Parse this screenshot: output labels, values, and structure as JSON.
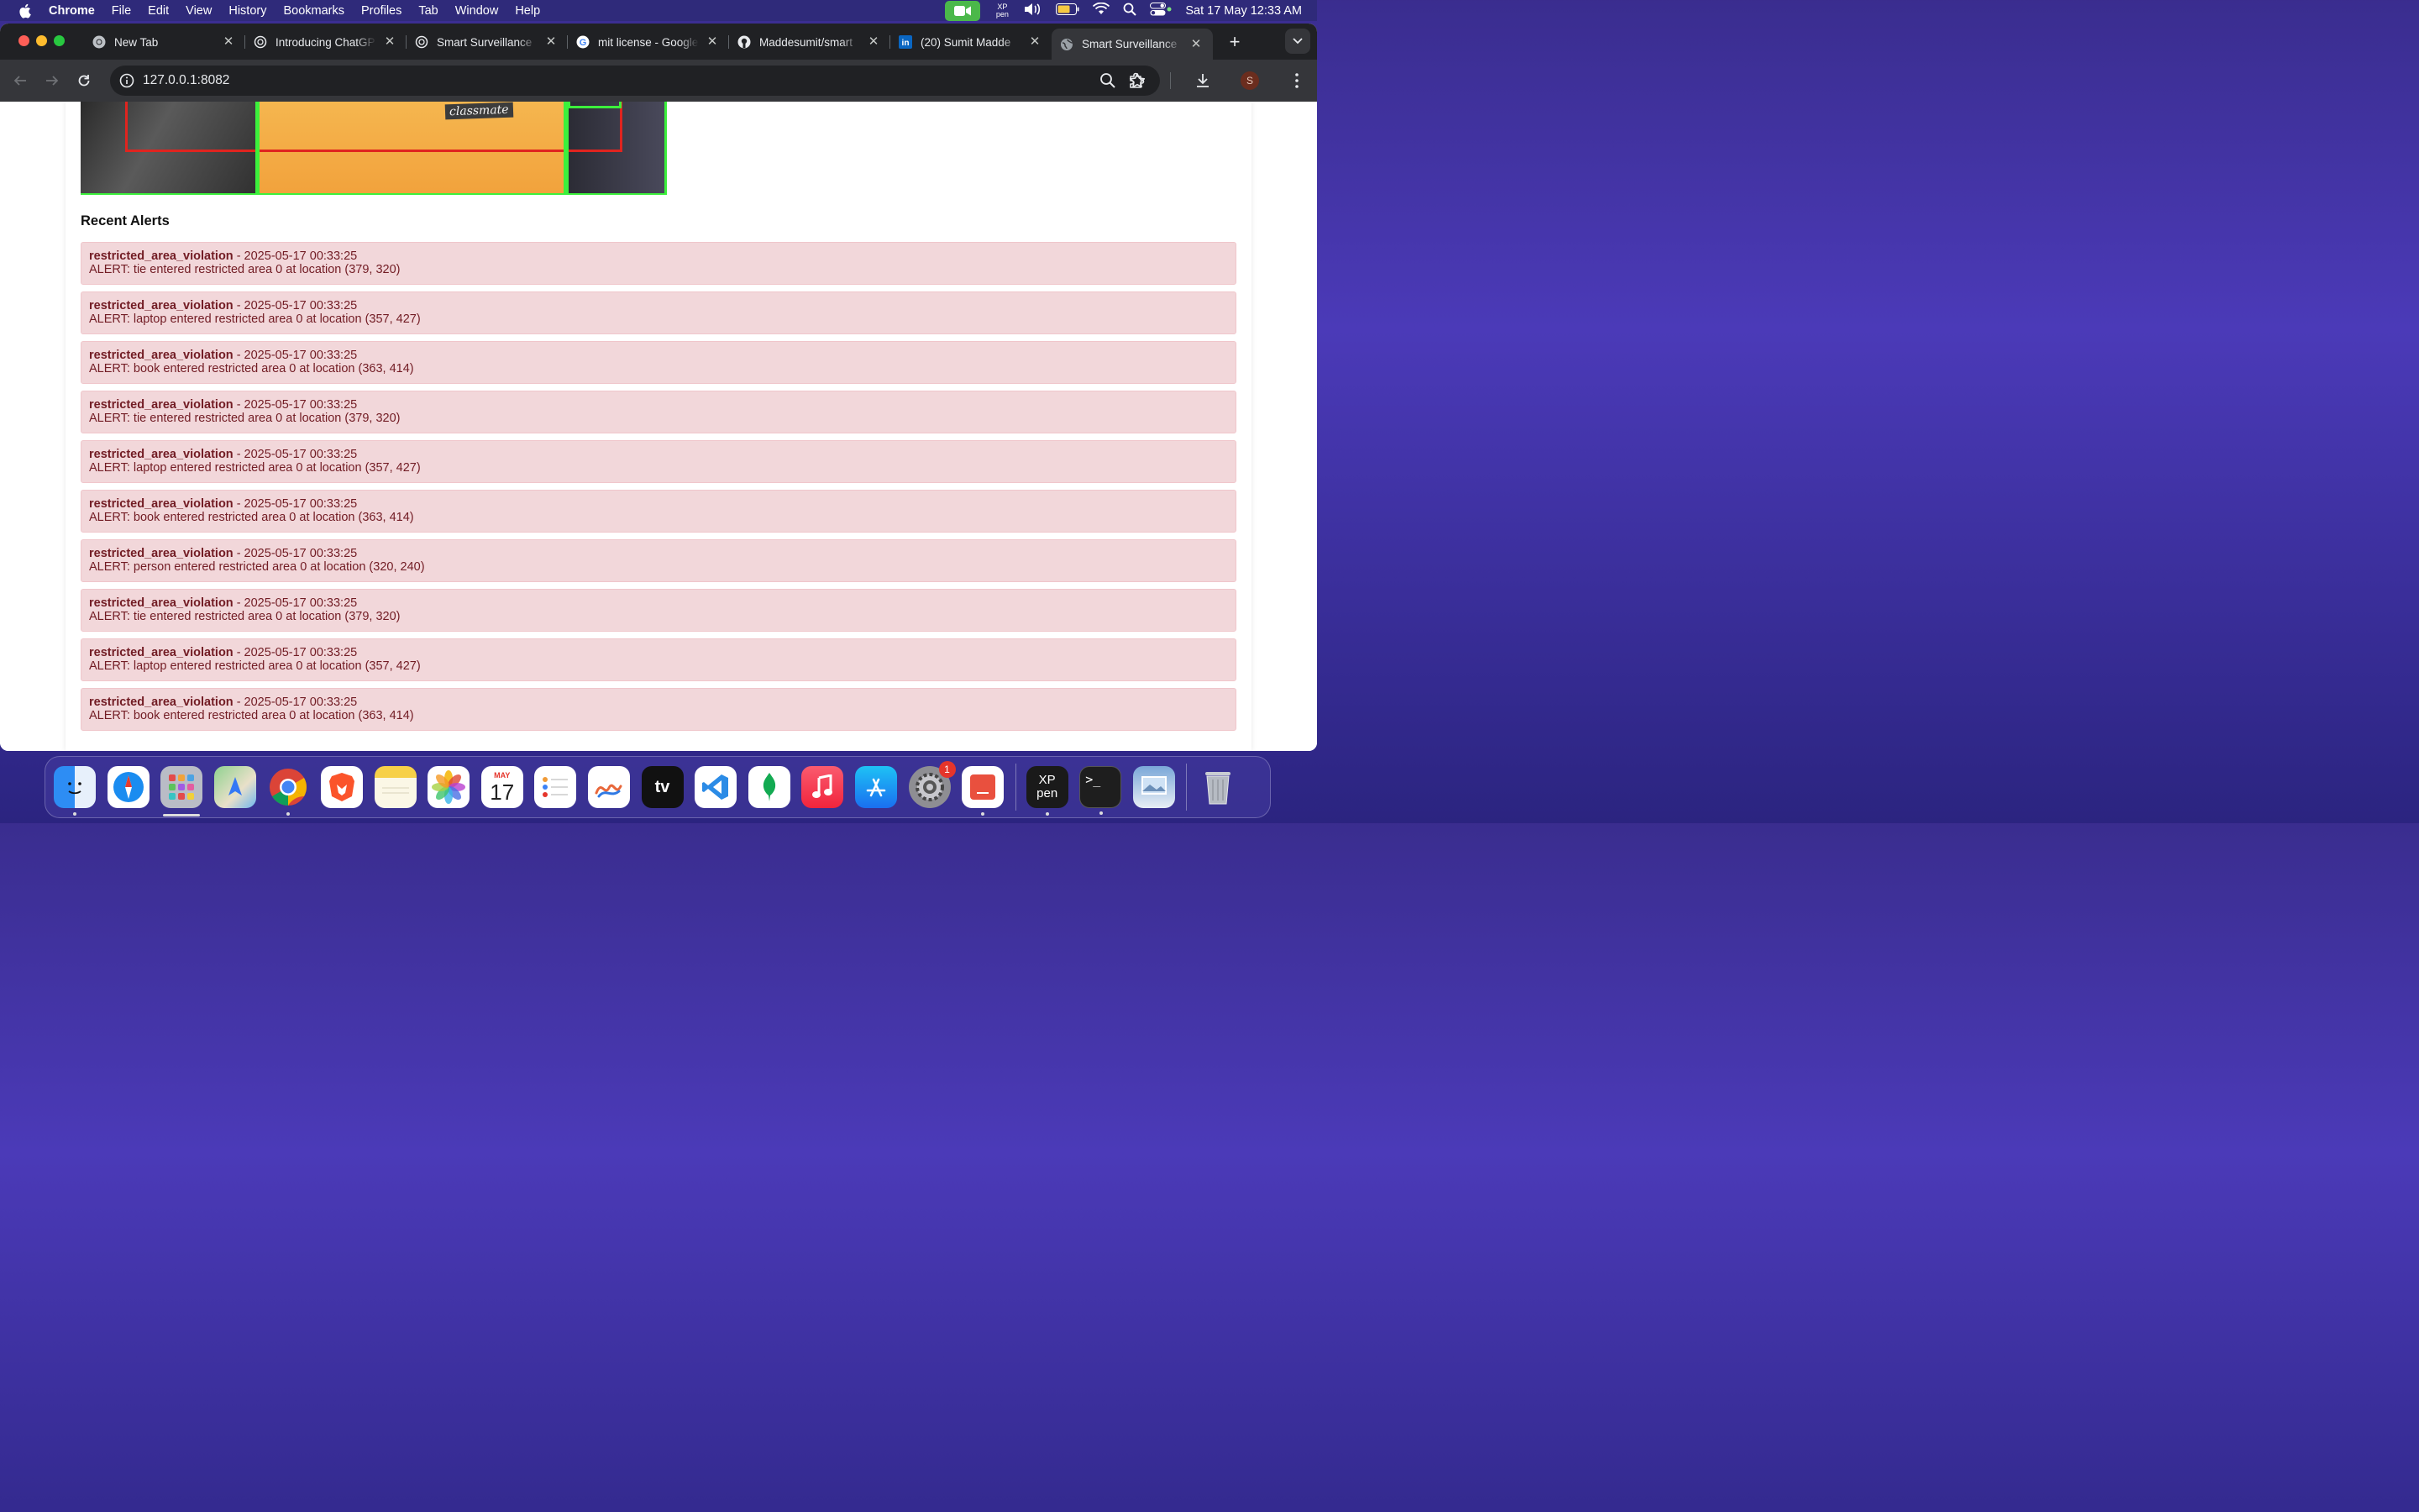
{
  "menubar": {
    "app": "Chrome",
    "items": [
      "File",
      "Edit",
      "View",
      "History",
      "Bookmarks",
      "Profiles",
      "Tab",
      "Window",
      "Help"
    ],
    "clock": "Sat 17 May  12:33 AM"
  },
  "tabs": [
    {
      "title": "New Tab",
      "icon": "chrome-icon"
    },
    {
      "title": "Introducing ChatGPT",
      "icon": "openai-icon"
    },
    {
      "title": "Smart Surveillance",
      "icon": "openai-icon"
    },
    {
      "title": "mit license - Google",
      "icon": "google-icon"
    },
    {
      "title": "Maddesumit/smart",
      "icon": "github-icon"
    },
    {
      "title": "(20) Sumit Madde",
      "icon": "linkedin-icon"
    },
    {
      "title": "Smart Surveillance",
      "icon": "globe-icon",
      "active": true
    }
  ],
  "toolbar": {
    "url": "127.0.0.1:8082",
    "avatar_letter": "S"
  },
  "feed": {
    "label": "classmate"
  },
  "alerts_section": {
    "title": "Recent Alerts",
    "items": [
      {
        "type": "restricted_area_violation",
        "time": " - 2025-05-17 00:33:25",
        "message": "ALERT: tie entered restricted area 0 at location (379, 320)"
      },
      {
        "type": "restricted_area_violation",
        "time": " - 2025-05-17 00:33:25",
        "message": "ALERT: laptop entered restricted area 0 at location (357, 427)"
      },
      {
        "type": "restricted_area_violation",
        "time": " - 2025-05-17 00:33:25",
        "message": "ALERT: book entered restricted area 0 at location (363, 414)"
      },
      {
        "type": "restricted_area_violation",
        "time": " - 2025-05-17 00:33:25",
        "message": "ALERT: tie entered restricted area 0 at location (379, 320)"
      },
      {
        "type": "restricted_area_violation",
        "time": " - 2025-05-17 00:33:25",
        "message": "ALERT: laptop entered restricted area 0 at location (357, 427)"
      },
      {
        "type": "restricted_area_violation",
        "time": " - 2025-05-17 00:33:25",
        "message": "ALERT: book entered restricted area 0 at location (363, 414)"
      },
      {
        "type": "restricted_area_violation",
        "time": " - 2025-05-17 00:33:25",
        "message": "ALERT: person entered restricted area 0 at location (320, 240)"
      },
      {
        "type": "restricted_area_violation",
        "time": " - 2025-05-17 00:33:25",
        "message": "ALERT: tie entered restricted area 0 at location (379, 320)"
      },
      {
        "type": "restricted_area_violation",
        "time": " - 2025-05-17 00:33:25",
        "message": "ALERT: laptop entered restricted area 0 at location (357, 427)"
      },
      {
        "type": "restricted_area_violation",
        "time": " - 2025-05-17 00:33:25",
        "message": "ALERT: book entered restricted area 0 at location (363, 414)"
      }
    ]
  },
  "dock": {
    "apps": [
      "finder-icon",
      "safari-icon",
      "launchpad-icon",
      "maps-icon",
      "chrome-icon",
      "brave-icon",
      "notes-icon",
      "photos-icon",
      "calendar-icon",
      "reminders-icon",
      "freeform-icon",
      "appletv-icon",
      "vscode-icon",
      "mongodb-icon",
      "music-icon",
      "appstore-icon",
      "system-settings-icon",
      "app-icon",
      "xppen-icon",
      "terminal-icon",
      "preview-icon",
      "trash-icon"
    ],
    "calendar_month": "MAY",
    "calendar_day": "17",
    "settings_badge": "1",
    "appletv_label": "tv",
    "xppen_label": "XP pen"
  },
  "colors": {
    "alert_bg": "#f2d7da",
    "alert_text": "#721c24",
    "box_red": "#e0241f",
    "box_green": "#3cf03c"
  }
}
